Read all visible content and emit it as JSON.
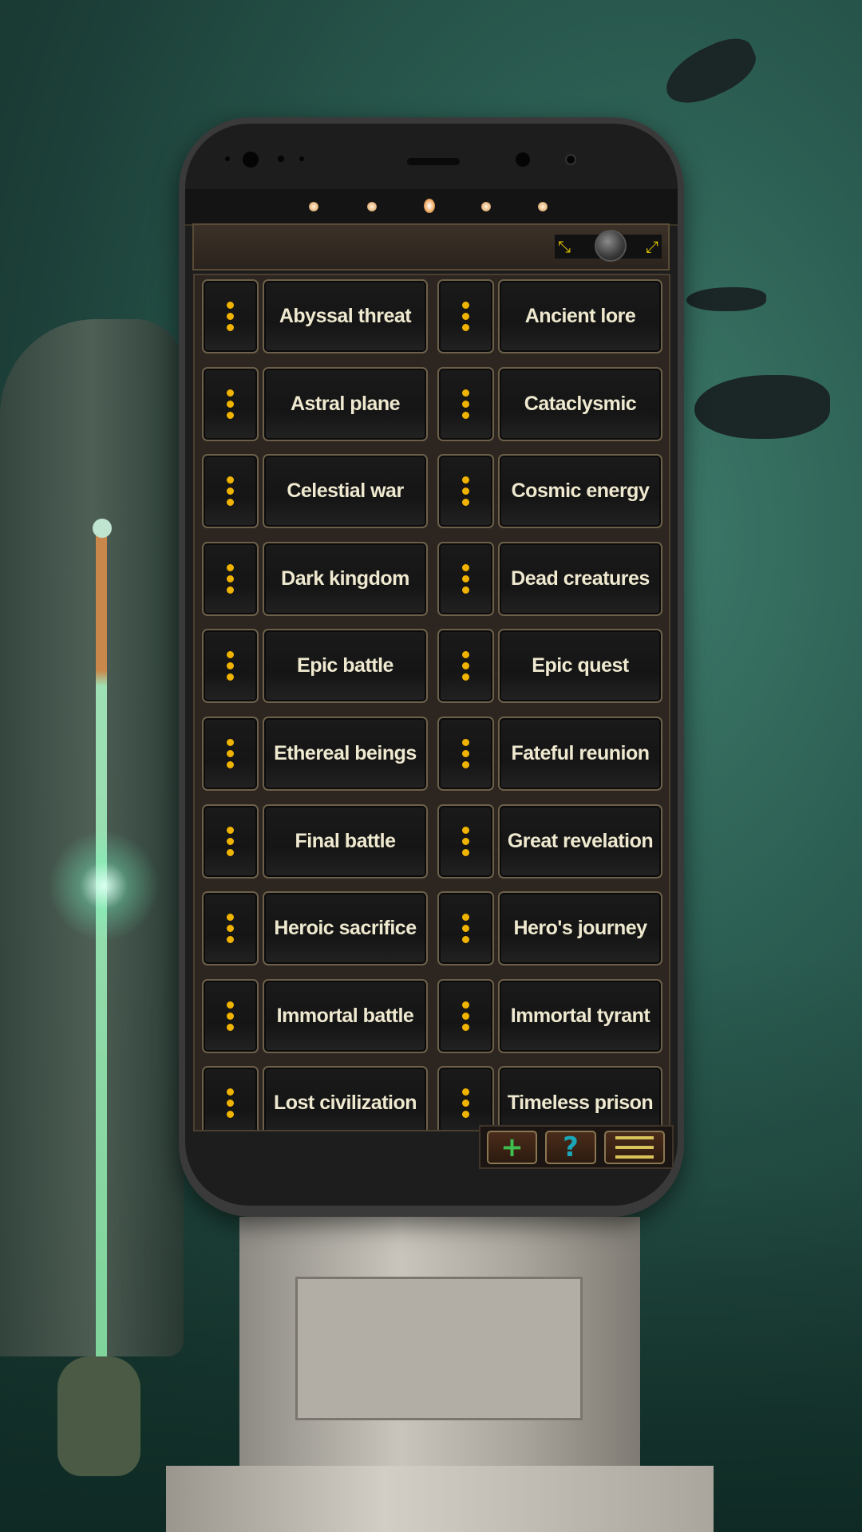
{
  "pager": {
    "page_count": 5,
    "active_page": 3
  },
  "header": {
    "zoom_out_icon": "collapse-arrows-icon",
    "zoom_in_icon": "expand-arrows-icon",
    "zoom_out_glyph": "⤡",
    "zoom_in_glyph": "⤢"
  },
  "items": [
    "Abyssal threat",
    "Ancient lore",
    "Astral plane",
    "Cataclysmic",
    "Celestial war",
    "Cosmic energy",
    "Dark kingdom",
    "Dead creatures",
    "Epic battle",
    "Epic quest",
    "Ethereal beings",
    "Fateful reunion",
    "Final battle",
    "Great revelation",
    "Heroic sacrifice",
    "Hero's journey",
    "Immortal battle",
    "Immortal tyrant",
    "Lost civilization",
    "Timeless prison",
    "",
    ""
  ],
  "toolbar": {
    "add_label": "+",
    "help_label": "?",
    "add_color": "#3fbf4f",
    "help_color": "#1aa7b8",
    "menu_icon": "hamburger-menu-icon"
  },
  "colors": {
    "dots": "#f0b400",
    "label_text": "#efe9d0",
    "border": "#6d604a"
  }
}
